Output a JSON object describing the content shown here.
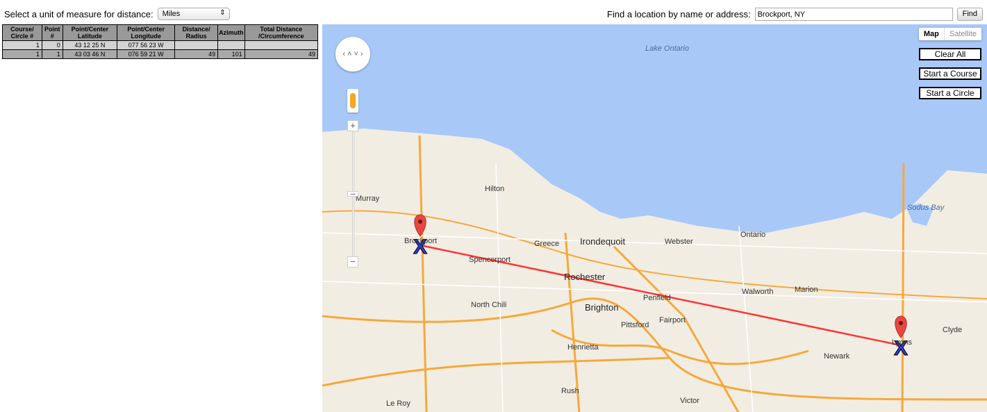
{
  "units": {
    "label": "Select a unit of measure for distance:",
    "selected": "Miles"
  },
  "find": {
    "label": "Find a location by name or address:",
    "value": "Brockport, NY",
    "button": "Find"
  },
  "table": {
    "headers": [
      "Course/ Circle #",
      "Point #",
      "Point/Center Latitude",
      "Point/Center Longitude",
      "Distance/ Radius",
      "Azimuth",
      "Total Distance /Circumference"
    ],
    "rows": [
      [
        "1",
        "0",
        "43 12 25 N",
        "077 56 23 W",
        "",
        "",
        ""
      ],
      [
        "1",
        "1",
        "43 03 46 N",
        "076 59 21 W",
        "49",
        "101",
        "49"
      ]
    ]
  },
  "map": {
    "type_map": "Map",
    "type_satellite": "Satellite",
    "clear_all": "Clear All",
    "start_course": "Start a Course",
    "start_circle": "Start a Circle",
    "zoom_in": "+",
    "zoom_out": "−",
    "lake": "Lake Ontario",
    "bay": "Sodus Bay",
    "places": [
      "Hilton",
      "Murray",
      "Brockport",
      "Greece",
      "Irondequoit",
      "Webster",
      "Ontario",
      "Spencerport",
      "Rochester",
      "Walworth",
      "Marion",
      "Penfield",
      "North Chili",
      "Brighton",
      "Fairport",
      "Pittsford",
      "Henrietta",
      "Newark",
      "Lyons",
      "Clyde",
      "Rush",
      "Le Roy",
      "Victor"
    ],
    "route_color": "#ff3333",
    "marker_color": "#e8473f",
    "water_color": "#a8c8f8"
  }
}
